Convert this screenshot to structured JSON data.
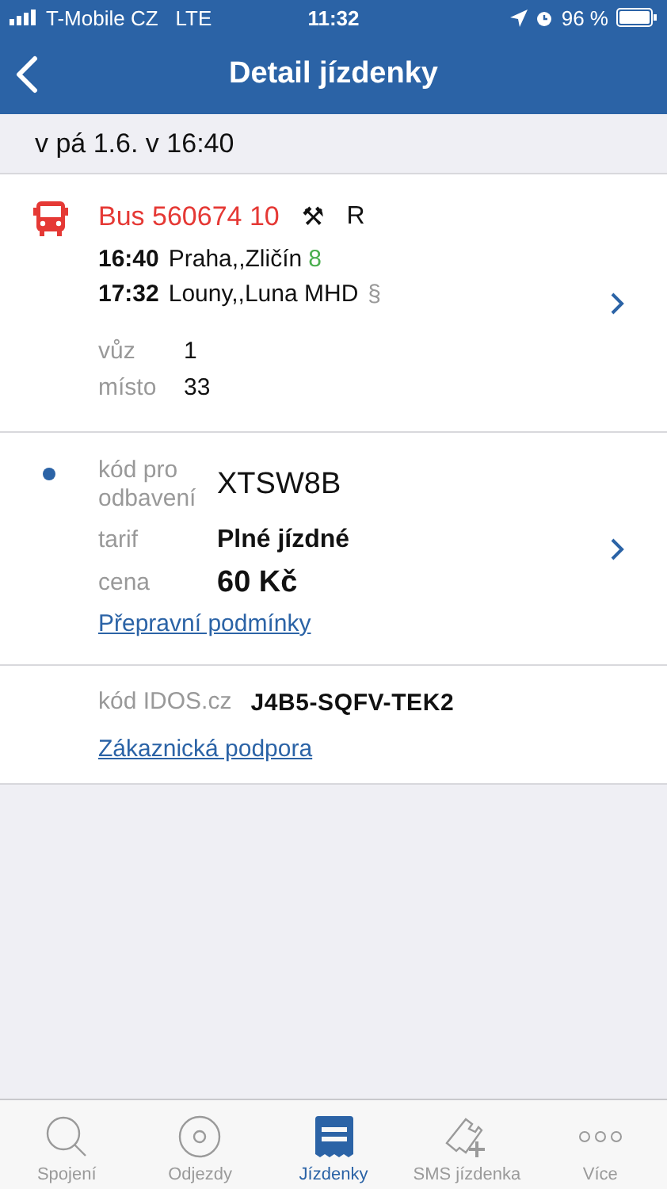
{
  "status_bar": {
    "carrier": "T-Mobile CZ",
    "network": "LTE",
    "time": "11:32",
    "battery": "96 %"
  },
  "nav": {
    "title": "Detail jízdenky"
  },
  "date_header": "v pá 1.6. v 16:40",
  "connection": {
    "line": "Bus 560674 10",
    "symbols": [
      "⚒",
      "R"
    ],
    "stops": [
      {
        "time": "16:40",
        "name": "Praha,,Zličín",
        "extra": "8",
        "kind": "platform"
      },
      {
        "time": "17:32",
        "name": "Louny,,Luna MHD",
        "extra": "§",
        "kind": "note"
      }
    ],
    "details": [
      {
        "label": "vůz",
        "value": "1"
      },
      {
        "label": "místo",
        "value": "33"
      }
    ]
  },
  "ticket": {
    "fields": [
      {
        "label": "kód pro odbavení",
        "value": "XTSW8B",
        "kind": "code"
      },
      {
        "label": "tarif",
        "value": "Plné jízdné",
        "kind": "tariff"
      },
      {
        "label": "cena",
        "value": "60 Kč",
        "kind": "price"
      }
    ],
    "link": "Přepravní podmínky"
  },
  "idos": {
    "label": "kód IDOS.cz",
    "value": "J4B5-SQFV-TEK2",
    "link": "Zákaznická podpora"
  },
  "tabs": [
    {
      "label": "Spojení",
      "kind": "search",
      "selected": false
    },
    {
      "label": "Odjezdy",
      "kind": "disc",
      "selected": false
    },
    {
      "label": "Jízdenky",
      "kind": "ticket",
      "selected": true
    },
    {
      "label": "SMS jízdenka",
      "kind": "sms",
      "selected": false
    },
    {
      "label": "Více",
      "kind": "more",
      "selected": false
    }
  ]
}
